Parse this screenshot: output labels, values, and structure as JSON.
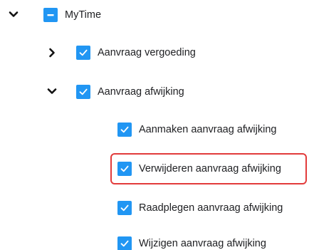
{
  "tree": {
    "root": {
      "label": "MyTime",
      "state": "indeterminate",
      "expanded": true,
      "expander_icon": "chevron-down-icon"
    },
    "children": [
      {
        "label": "Aanvraag vergoeding",
        "state": "checked",
        "expanded": false,
        "expander_icon": "chevron-right-icon"
      },
      {
        "label": "Aanvraag afwijking",
        "state": "checked",
        "expanded": true,
        "expander_icon": "chevron-down-icon",
        "children": [
          {
            "label": "Aanmaken aanvraag afwijking",
            "state": "checked"
          },
          {
            "label": "Verwijderen aanvraag afwijking",
            "state": "checked",
            "highlighted": true
          },
          {
            "label": "Raadplegen aanvraag afwijking",
            "state": "checked"
          },
          {
            "label": "Wijzigen aanvraag afwijking",
            "state": "checked"
          }
        ]
      }
    ]
  },
  "colors": {
    "checkbox": "#2196f3",
    "highlight": "#e23b3b",
    "text": "#202124",
    "chevron": "#111111"
  }
}
